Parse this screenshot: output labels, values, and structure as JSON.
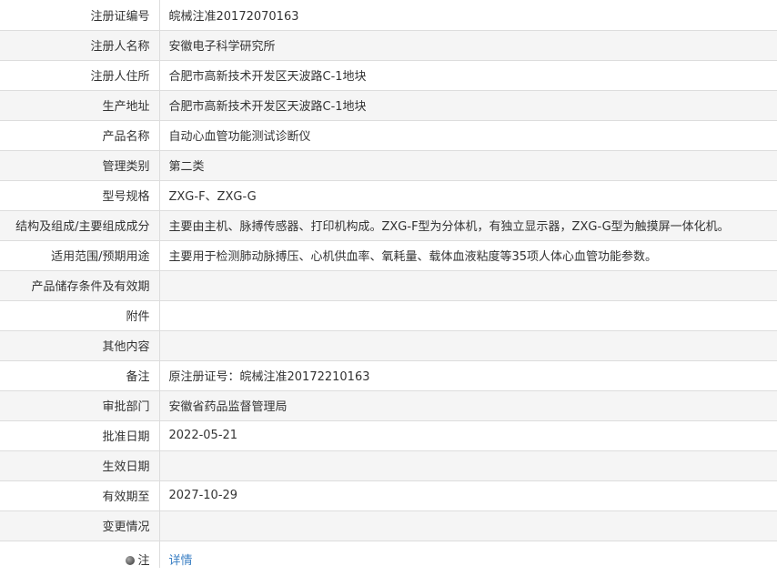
{
  "rows": [
    {
      "label": "注册证编号",
      "value": "皖械注准20172070163"
    },
    {
      "label": "注册人名称",
      "value": "安徽电子科学研究所"
    },
    {
      "label": "注册人住所",
      "value": "合肥市高新技术开发区天波路C-1地块"
    },
    {
      "label": "生产地址",
      "value": "合肥市高新技术开发区天波路C-1地块"
    },
    {
      "label": "产品名称",
      "value": "自动心血管功能测试诊断仪"
    },
    {
      "label": "管理类别",
      "value": "第二类"
    },
    {
      "label": "型号规格",
      "value": "ZXG-F、ZXG-G"
    },
    {
      "label": "结构及组成/主要组成成分",
      "value": "主要由主机、脉搏传感器、打印机构成。ZXG-F型为分体机，有独立显示器，ZXG-G型为触摸屏一体化机。"
    },
    {
      "label": "适用范围/预期用途",
      "value": "主要用于检测肺动脉搏压、心机供血率、氧耗量、载体血液粘度等35项人体心血管功能参数。"
    },
    {
      "label": "产品储存条件及有效期",
      "value": ""
    },
    {
      "label": "附件",
      "value": ""
    },
    {
      "label": "其他内容",
      "value": ""
    },
    {
      "label": "备注",
      "value": "原注册证号：皖械注准20172210163"
    },
    {
      "label": "审批部门",
      "value": "安徽省药品监督管理局"
    },
    {
      "label": "批准日期",
      "value": "2022-05-21"
    },
    {
      "label": "生效日期",
      "value": ""
    },
    {
      "label": "有效期至",
      "value": "2027-10-29"
    },
    {
      "label": "变更情况",
      "value": ""
    }
  ],
  "note": {
    "label": "注",
    "icon": "info-dot-icon",
    "link_text": "详情"
  }
}
